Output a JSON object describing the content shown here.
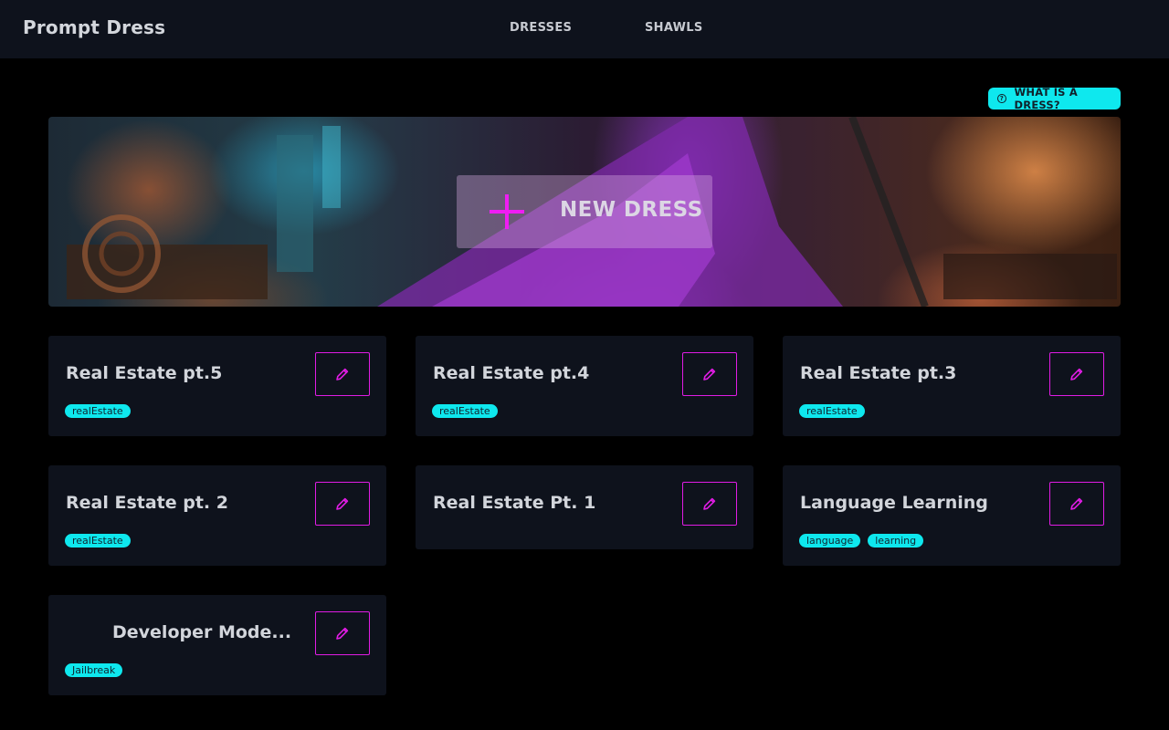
{
  "app": {
    "brand": "Prompt Dress"
  },
  "nav": {
    "dresses": "DRESSES",
    "shawls": "SHAWLS"
  },
  "help": {
    "label": "WHAT IS A DRESS?",
    "icon": "question-circle-icon"
  },
  "hero": {
    "cta_label": "NEW DRESS",
    "cta_icon": "plus-icon"
  },
  "colors": {
    "accent_cyan": "#0ee8ee",
    "accent_magenta": "#e01ce4",
    "panel": "#0e121c",
    "background": "#000000"
  },
  "cards": [
    {
      "title": "Real Estate pt.5",
      "tags": [
        "realEstate"
      ]
    },
    {
      "title": "Real Estate pt.4",
      "tags": [
        "realEstate"
      ]
    },
    {
      "title": "Real Estate pt.3",
      "tags": [
        "realEstate"
      ]
    },
    {
      "title": "Real Estate pt. 2",
      "tags": [
        "realEstate"
      ]
    },
    {
      "title": "Real Estate Pt. 1",
      "tags": []
    },
    {
      "title": "Language Learning",
      "tags": [
        "language",
        "learning"
      ]
    },
    {
      "title": "Developer Mode...",
      "tags": [
        "Jailbreak"
      ]
    }
  ]
}
